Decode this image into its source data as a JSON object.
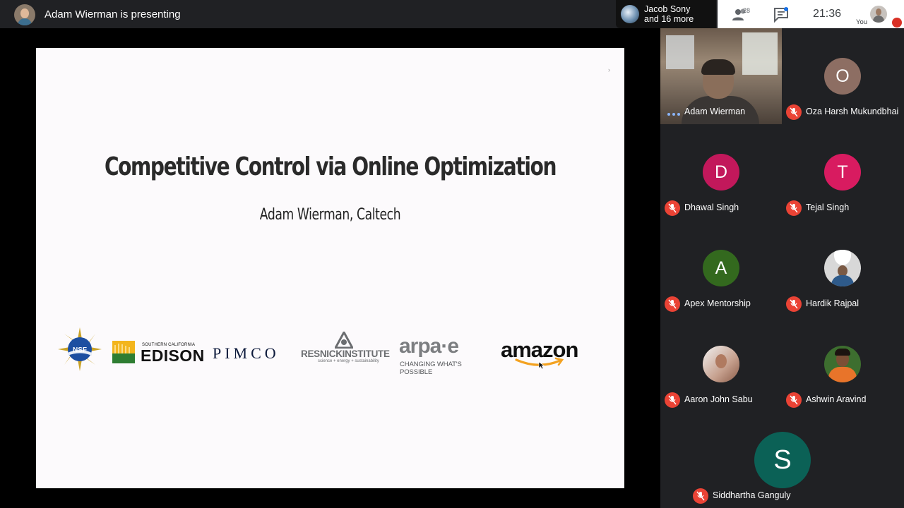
{
  "header": {
    "presenting_text": "Adam Wierman is presenting",
    "chat_preview_line1": "Jacob Sony",
    "chat_preview_line2": "and 16 more",
    "people_count": "28",
    "clock": "21:36",
    "you_label": "You"
  },
  "slide": {
    "title": "Competitive Control via Online Optimization",
    "subtitle": "Adam Wierman, Caltech",
    "corner_mark": "›",
    "logos": {
      "nsf": "NSF",
      "edison_small": "SOUTHERN CALIFORNIA",
      "edison_big": "EDISON",
      "pimco": "PIMCO",
      "resnick": "RESNICKINSTITUTE",
      "resnick_sub": "science + energy + sustainability",
      "arpae": "arpa·e",
      "arpae_sub": "CHANGING WHAT'S POSSIBLE",
      "amazon": "amazon"
    }
  },
  "participants": {
    "presenter": {
      "name": "Adam Wierman"
    },
    "tiles": [
      {
        "name": "Oza Harsh Mukundbhai",
        "initial": "O",
        "color": "#8d6e63"
      },
      {
        "name": "Dhawal Singh",
        "initial": "D",
        "color": "#c2185b"
      },
      {
        "name": "Tejal Singh",
        "initial": "T",
        "color": "#d81b60"
      },
      {
        "name": "Apex Mentorship",
        "initial": "A",
        "color": "#33691e"
      },
      {
        "name": "Hardik Rajpal",
        "initial": ""
      },
      {
        "name": "Aaron John Sabu",
        "initial": ""
      },
      {
        "name": "Ashwin Aravind",
        "initial": ""
      }
    ],
    "large": {
      "name": "Siddhartha Ganguly",
      "initial": "S",
      "color": "#0b6156"
    }
  },
  "colors": {
    "background": "#202124",
    "mic_muted": "#ea4335",
    "slide_bg": "#fcfafc"
  }
}
